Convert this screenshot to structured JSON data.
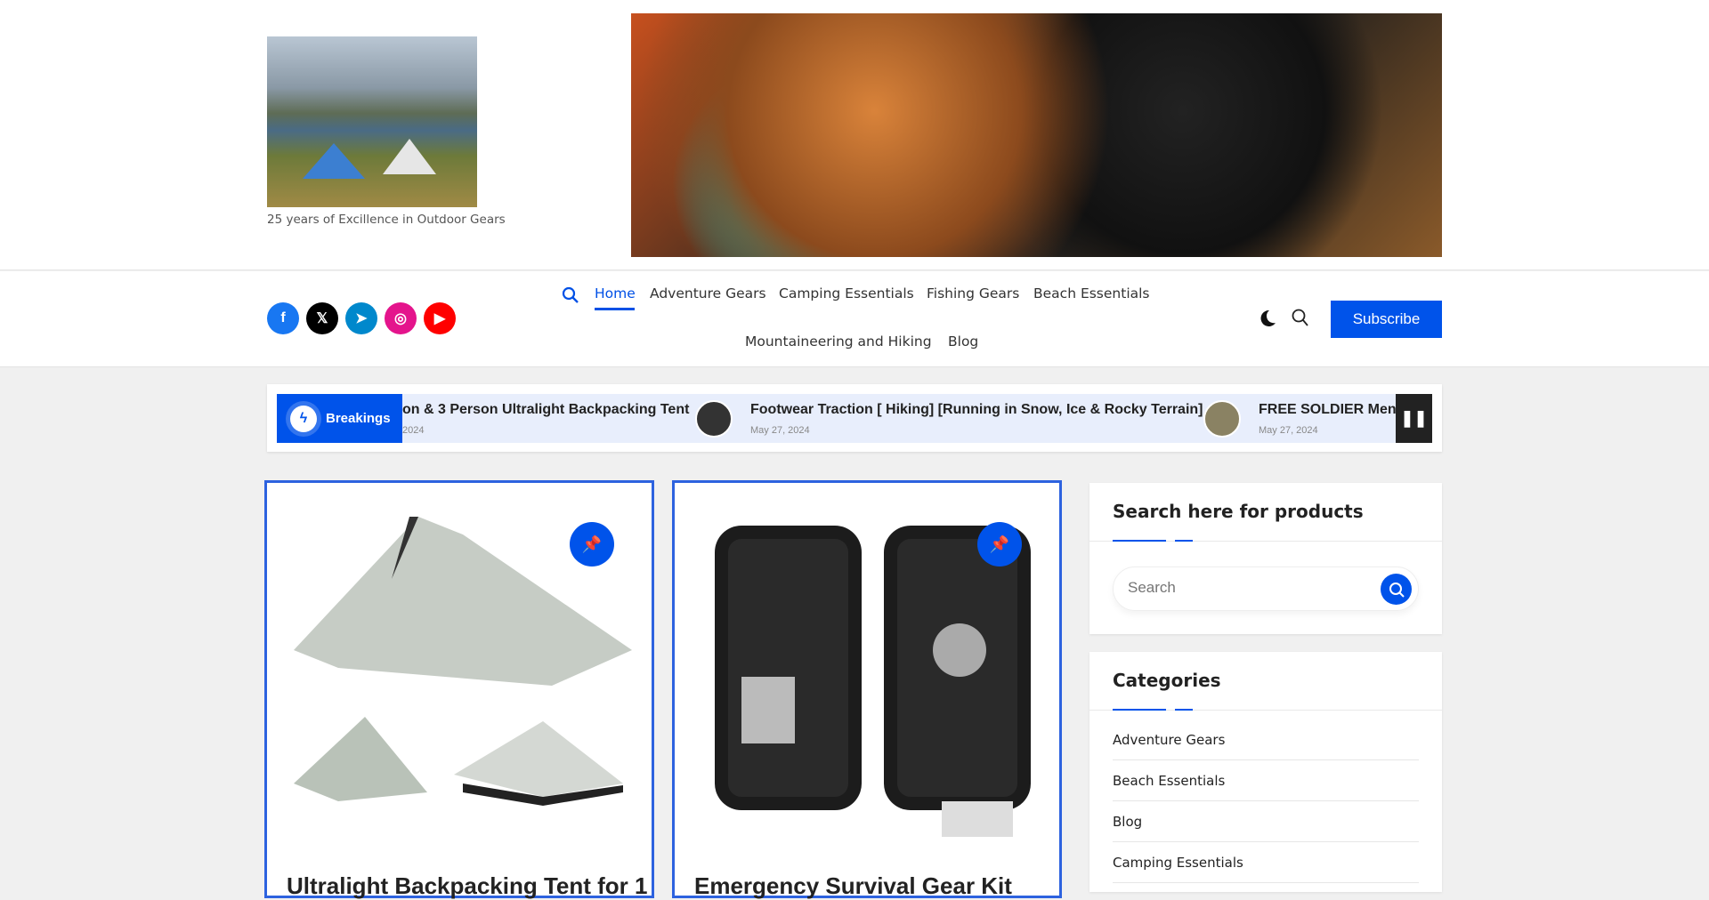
{
  "header": {
    "tagline": "25 years of Excillence in Outdoor Gears"
  },
  "social": [
    {
      "name": "facebook",
      "glyph": "f",
      "color": "#1877f2"
    },
    {
      "name": "x",
      "glyph": "𝕏",
      "color": "#000000"
    },
    {
      "name": "telegram",
      "glyph": "➤",
      "color": "#0088cc"
    },
    {
      "name": "instagram",
      "glyph": "◎",
      "color": "#e4148c"
    },
    {
      "name": "youtube",
      "glyph": "▶",
      "color": "#ff0000"
    }
  ],
  "nav": {
    "items": [
      "Home",
      "Adventure Gears",
      "Camping Essentials",
      "Fishing Gears",
      "Beach Essentials",
      "Mountaineering and Hiking",
      "Blog"
    ],
    "active": "Home",
    "subscribe": "Subscribe"
  },
  "ticker": {
    "label": "Breakings",
    "items": [
      {
        "title": "on & 3 Person Ultralight Backpacking Tent",
        "date": "2024"
      },
      {
        "title": "Footwear Traction [ Hiking] [Running in Snow, Ice & Rocky Terrain]",
        "date": "May 27, 2024"
      },
      {
        "title": "FREE SOLDIER Men",
        "date": "May 27, 2024"
      }
    ]
  },
  "posts": [
    {
      "title": "Ultralight Backpacking Tent for 1"
    },
    {
      "title": "Emergency Survival Gear Kit"
    }
  ],
  "sidebar": {
    "search_title": "Search here for products",
    "search_placeholder": "Search",
    "categories_title": "Categories",
    "categories": [
      "Adventure Gears",
      "Beach Essentials",
      "Blog",
      "Camping Essentials"
    ]
  },
  "colors": {
    "accent": "#0053ea",
    "card_border": "#2d62df"
  }
}
